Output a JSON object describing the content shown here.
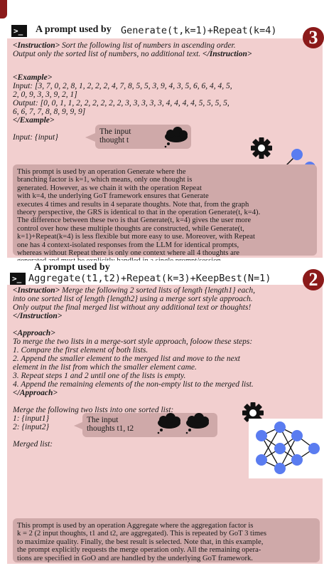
{
  "panel1": {
    "title_bold": "A prompt used by",
    "title_code": "Generate(t,k=1)+Repeat(k=4)",
    "badge": "3",
    "instruction_open": "<Instruction>",
    "instruction_line1": "Sort the following list of numbers in ascending order.",
    "instruction_line2": "Output only the sorted list of numbers, no additional text.",
    "instruction_close": "</Instruction>",
    "example_open": "<Example>",
    "example_lines": [
      "Input: [3, 7, 0, 2, 8, 1, 2, 2, 2, 4, 7, 8, 5, 5, 3, 9, 4, 3, 5, 6, 6, 4, 4, 5,",
      "2, 0, 9, 3, 3, 9, 2, 1]",
      "Output: [0, 0, 1, 1, 2, 2, 2, 2, 2, 2, 3, 3, 3, 3, 3, 4, 4, 4, 4, 5, 5, 5, 5,",
      "6, 6, 7, 7, 8, 8, 9, 9, 9]"
    ],
    "example_close": "</Example>",
    "input_line": "Input: {input}",
    "bubble_line1": "The input",
    "bubble_line2": "thought t",
    "explanation": [
      "This prompt is used by an operation Generate where the",
      "branching factor is k=1, which means, only one thought is",
      "generated. However, as we chain it with the operation Repeat",
      "with k=4, the underlying GoT framework ensures that Generate",
      "executes 4 times and results in 4 separate thoughts. Note that, from the graph",
      "theory perspective, the GRS is identical to that in the operation Generate(t, k=4).",
      "The difference between these two is that Generate(t, k=4) gives the user more",
      "control over how these multiple thoughts are constructed, while Generate(t,",
      "k=1)+Repeat(k=4) is less flexible but more easy to use. Moreover, with Repeat",
      "one has 4 context-isolated responses from the LLM for identical prompts,",
      "whereas without Repeat there is only one context where all 4 thoughts are",
      "generated and must be explicitly handled in a single prompt/session."
    ]
  },
  "panel2": {
    "title_bold": "A prompt used by",
    "title_code": "Aggregate(t1,t2)+Repeat(k=3)+KeepBest(N=1)",
    "badge": "2",
    "instruction_open": "<Instruction>",
    "instruction_lines": [
      "Merge the following 2 sorted lists of length {length1} each,",
      "into one sorted list of length {length2} using a merge sort style approach.",
      "Only output the final merged list without any additional text or thoughts!"
    ],
    "instruction_close": "</Instruction>",
    "approach_open": "<Approach>",
    "approach_lines": [
      "To merge the two lists in a merge-sort style approach, foloow these steps:",
      "1. Compare the first element of both lists.",
      "2. Append the smaller element to the merged list and move to the next",
      "element in the list from which the smaller element came.",
      "3. Repeat steps 1 and 2 until one of the lists is empty.",
      "4. Append the remaining elements of the non-empty list to the merged list."
    ],
    "approach_close": "</Approach>",
    "merge_lines": [
      "Merge the following two lists into one sorted list:",
      "1: {input1}",
      "2: {input2}"
    ],
    "merged_list": "Merged list:",
    "bubble_line1": "The input",
    "bubble_line2": "thoughts t1, t2",
    "explanation": [
      "This prompt is used by an operation Aggregate where the aggregation factor is",
      "k = 2 (2 input thoughts, t1 and t2, are aggregated). This is repeated by GoT 3 times",
      "to maximize quality. Finally, the best result is selected. Note that, in this example,",
      "the prompt explicitly requests the merge operation only. All the remaining opera-",
      "tions are specified in GoO and are handled by the underlying GoT framework."
    ]
  },
  "colors": {
    "panel": "#f2cfcf",
    "bubble": "#cfa9a9",
    "badge": "#8b1a1a",
    "node": "#5a7cf0"
  }
}
